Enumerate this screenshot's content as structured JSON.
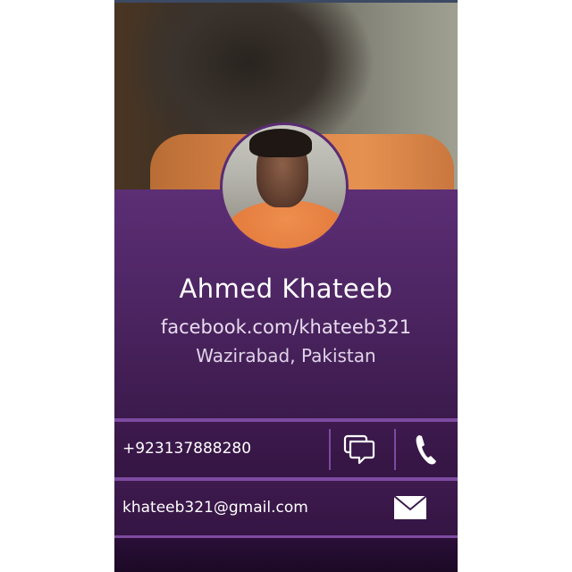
{
  "profile": {
    "name": "Ahmed Khateeb",
    "facebook": "facebook.com/khateeb321",
    "location": "Wazirabad, Pakistan"
  },
  "contacts": {
    "phone": "+923137888280",
    "email": "khateeb321@gmail.com"
  },
  "icons": {
    "message": "message-bubble-icon",
    "call": "phone-handset-icon",
    "mail": "envelope-icon"
  },
  "colors": {
    "panel": "#5c2e75",
    "divider": "#7d4aa0",
    "text": "#ffffff"
  }
}
